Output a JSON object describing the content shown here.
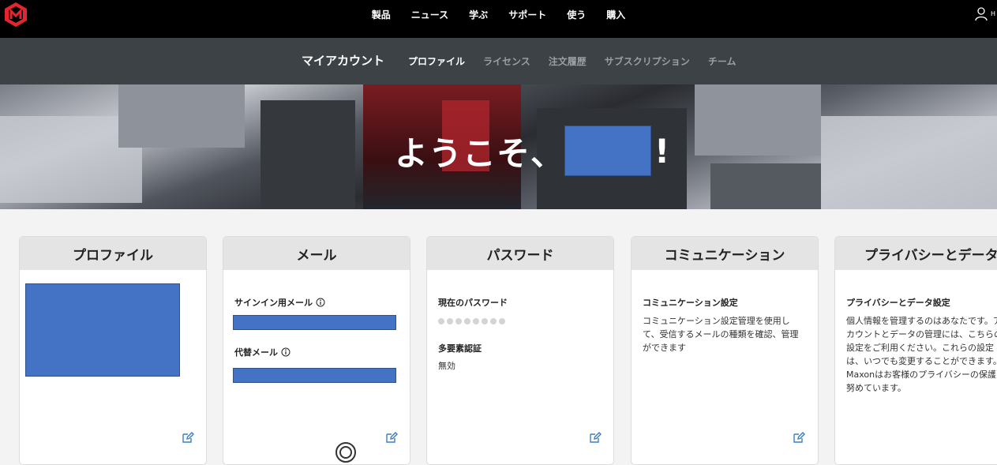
{
  "top_nav": {
    "items": [
      "製品",
      "ニュース",
      "学ぶ",
      "サポート",
      "使う",
      "購入"
    ],
    "user_initial": "H"
  },
  "sub_nav": {
    "title": "マイアカウント",
    "items": [
      "プロファイル",
      "ライセンス",
      "注文履歴",
      "サブスクリプション",
      "チーム"
    ],
    "active_index": 0
  },
  "hero": {
    "greeting": "ようこそ、",
    "suffix": "!"
  },
  "cards": {
    "profile": {
      "title": "プロファイル"
    },
    "mail": {
      "title": "メール",
      "signin_label": "サインイン用メール",
      "alt_label": "代替メール"
    },
    "password": {
      "title": "パスワード",
      "current_label": "現在のパスワード",
      "mfa_label": "多要素認証",
      "mfa_value": "無効"
    },
    "communication": {
      "title": "コミュニケーション",
      "settings_label": "コミュニケーション設定",
      "description": "コミュニケーション設定管理を使用して、受信するメールの種類を確認、管理ができます"
    },
    "privacy": {
      "title": "プライバシーとデータ",
      "settings_label": "プライバシーとデータ設定",
      "description": "個人情報を管理するのはあなたです。アカウントとデータの管理には、こちらの設定をご利用ください。これらの設定は、いつでも変更することができます。Maxonはお客様のプライバシーの保護に努めています。"
    }
  },
  "colors": {
    "brand_red": "#e3262e",
    "redaction_blue": "#4472c4",
    "subbar_bg": "#3d4246"
  },
  "icons": [
    "maxon-logo-icon",
    "user-icon",
    "info-icon",
    "edit-icon"
  ]
}
